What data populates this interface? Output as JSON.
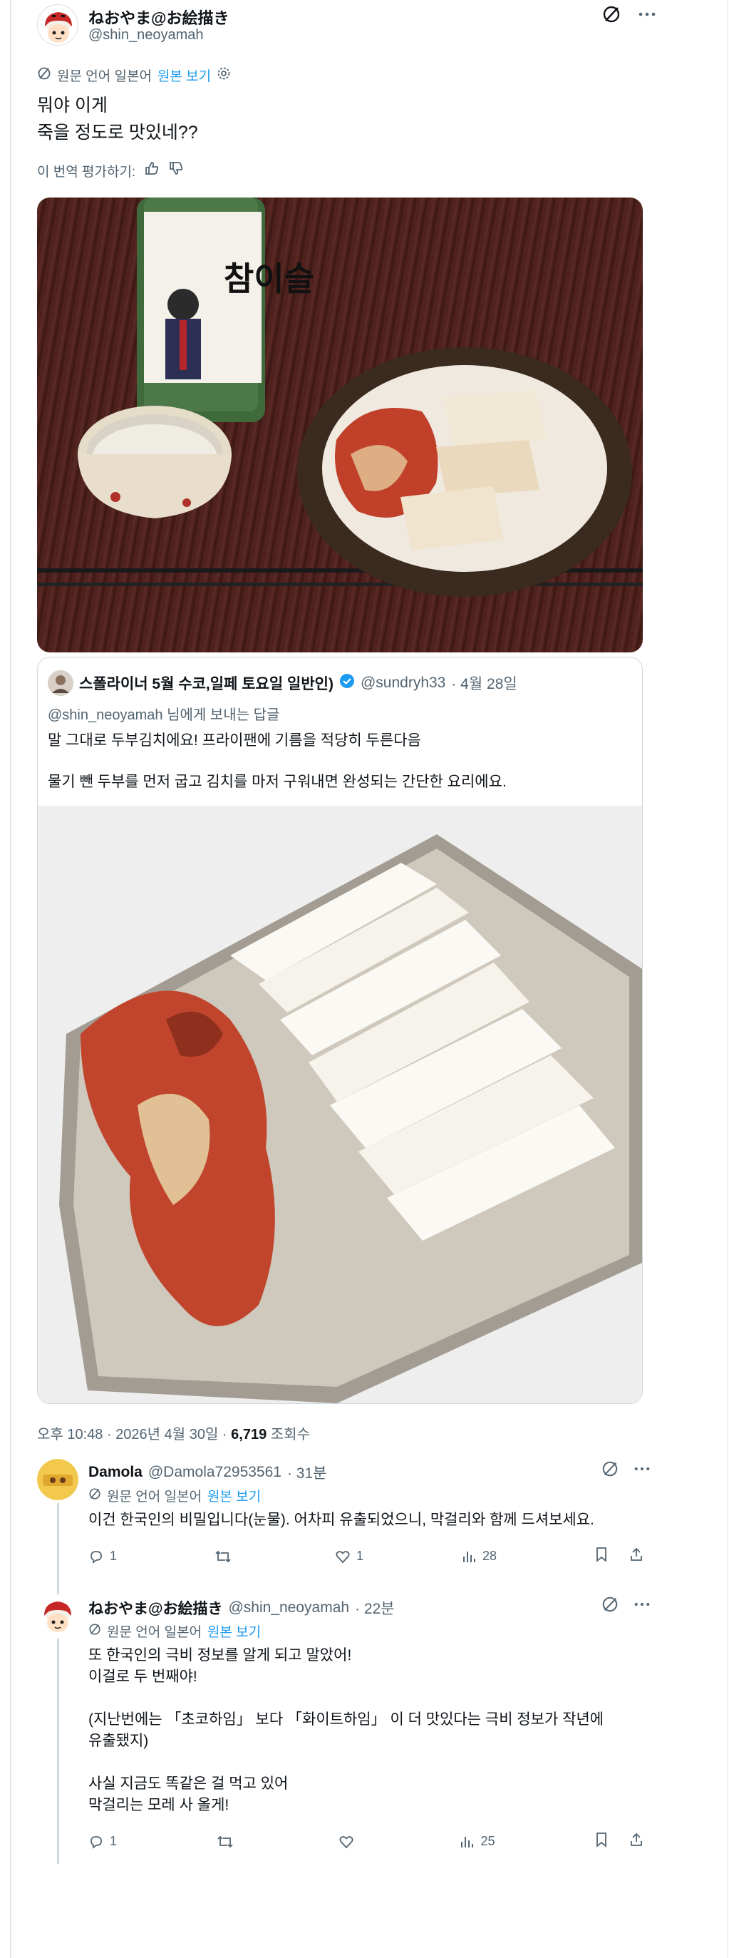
{
  "tweet": {
    "author_name": "ねおやま@お絵描き",
    "author_handle": "@shin_neoyamah",
    "translate_label": "원문 언어 일본어",
    "view_original": "원본 보기",
    "text": "뭐야 이게\n죽을 정도로 맛있네??",
    "rate_label": "이 번역 평가하기:",
    "photo_bottle_text": "참이슬",
    "meta_time": "오후 10:48 · 2026년 4월 30일 · ",
    "meta_views": "6,719",
    "meta_views_label": " 조회수"
  },
  "quote": {
    "author_name": "스폴라이너 5월 수코,일페 토요일 일반인)",
    "author_handle": "@sundryh33",
    "date": "· 4월 28일",
    "reply_to_handle": "@shin_neoyamah",
    "reply_to_suffix": " 님에게 보내는 답글",
    "text1": "말 그대로 두부김치에요! 프라이팬에 기름을 적당히 두른다음",
    "text2": "물기 뺀 두부를 먼저 굽고 김치를 마저 구워내면 완성되는 간단한 요리에요."
  },
  "replies": [
    {
      "author_name": "Damola",
      "author_handle": "@Damola72953561",
      "time": "· 31분",
      "translate_label": "원문 언어 일본어",
      "view_original": "원본 보기",
      "text": "이건 한국인의 비밀입니다(눈물). 어차피 유출되었으니, 막걸리와 함께 드셔보세요.",
      "reply_count": "1",
      "retweet_count": "",
      "like_count": "1",
      "view_count": "28"
    },
    {
      "author_name": "ねおやま@お絵描き",
      "author_handle": "@shin_neoyamah",
      "time": "· 22분",
      "translate_label": "원문 언어 일본어",
      "view_original": "원본 보기",
      "text": "또 한국인의 극비 정보를 알게 되고 말았어!\n이걸로 두 번째야!\n\n(지난번에는 「초코하임」 보다 「화이트하임」 이 더 맛있다는 극비 정보가 작년에\n유출됐지)\n\n사실 지금도 똑같은 걸 먹고 있어\n막걸리는 모레 사 올게!",
      "reply_count": "1",
      "retweet_count": "",
      "like_count": "",
      "view_count": "25"
    }
  ],
  "colors": {
    "link": "#1d9bf0",
    "muted": "#536471",
    "verified": "#1d9bf0"
  }
}
